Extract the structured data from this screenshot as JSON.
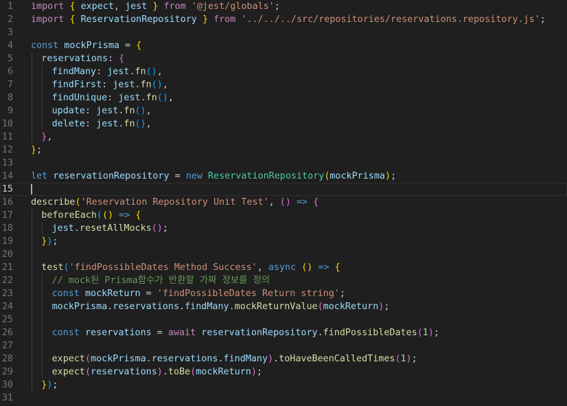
{
  "editor": {
    "caret_line": 15,
    "lines": [
      {
        "n": "1",
        "indent": 0,
        "tokens": [
          [
            "kw",
            "import"
          ],
          [
            "p",
            " "
          ],
          [
            "b1",
            "{"
          ],
          [
            "p",
            " "
          ],
          [
            "var",
            "expect"
          ],
          [
            "p",
            ", "
          ],
          [
            "var",
            "jest"
          ],
          [
            "p",
            " "
          ],
          [
            "b1",
            "}"
          ],
          [
            "p",
            " "
          ],
          [
            "kw",
            "from"
          ],
          [
            "p",
            " "
          ],
          [
            "str",
            "'@jest/globals'"
          ],
          [
            "p",
            ";"
          ]
        ]
      },
      {
        "n": "2",
        "indent": 0,
        "tokens": [
          [
            "kw",
            "import"
          ],
          [
            "p",
            " "
          ],
          [
            "b1",
            "{"
          ],
          [
            "p",
            " "
          ],
          [
            "var",
            "ReservationRepository"
          ],
          [
            "p",
            " "
          ],
          [
            "b1",
            "}"
          ],
          [
            "p",
            " "
          ],
          [
            "kw",
            "from"
          ],
          [
            "p",
            " "
          ],
          [
            "str",
            "'../../../src/repositories/reservations.repository.js'"
          ],
          [
            "p",
            ";"
          ]
        ]
      },
      {
        "n": "3",
        "indent": 0,
        "tokens": []
      },
      {
        "n": "4",
        "indent": 0,
        "tokens": [
          [
            "st",
            "const"
          ],
          [
            "p",
            " "
          ],
          [
            "var",
            "mockPrisma"
          ],
          [
            "p",
            " = "
          ],
          [
            "b1",
            "{"
          ]
        ]
      },
      {
        "n": "5",
        "indent": 1,
        "tokens": [
          [
            "var",
            "reservations"
          ],
          [
            "p",
            ": "
          ],
          [
            "b2",
            "{"
          ]
        ]
      },
      {
        "n": "6",
        "indent": 2,
        "tokens": [
          [
            "var",
            "findMany"
          ],
          [
            "p",
            ": "
          ],
          [
            "var",
            "jest"
          ],
          [
            "p",
            "."
          ],
          [
            "fn",
            "fn"
          ],
          [
            "b3",
            "()"
          ],
          [
            "p",
            ","
          ]
        ]
      },
      {
        "n": "7",
        "indent": 2,
        "tokens": [
          [
            "var",
            "findFirst"
          ],
          [
            "p",
            ": "
          ],
          [
            "var",
            "jest"
          ],
          [
            "p",
            "."
          ],
          [
            "fn",
            "fn"
          ],
          [
            "b3",
            "()"
          ],
          [
            "p",
            ","
          ]
        ]
      },
      {
        "n": "8",
        "indent": 2,
        "tokens": [
          [
            "var",
            "findUnique"
          ],
          [
            "p",
            ": "
          ],
          [
            "var",
            "jest"
          ],
          [
            "p",
            "."
          ],
          [
            "fn",
            "fn"
          ],
          [
            "b3",
            "()"
          ],
          [
            "p",
            ","
          ]
        ]
      },
      {
        "n": "9",
        "indent": 2,
        "tokens": [
          [
            "var",
            "update"
          ],
          [
            "p",
            ": "
          ],
          [
            "var",
            "jest"
          ],
          [
            "p",
            "."
          ],
          [
            "fn",
            "fn"
          ],
          [
            "b3",
            "()"
          ],
          [
            "p",
            ","
          ]
        ]
      },
      {
        "n": "10",
        "indent": 2,
        "tokens": [
          [
            "var",
            "delete"
          ],
          [
            "p",
            ": "
          ],
          [
            "var",
            "jest"
          ],
          [
            "p",
            "."
          ],
          [
            "fn",
            "fn"
          ],
          [
            "b3",
            "()"
          ],
          [
            "p",
            ","
          ]
        ]
      },
      {
        "n": "11",
        "indent": 1,
        "tokens": [
          [
            "b2",
            "}"
          ],
          [
            "p",
            ","
          ]
        ]
      },
      {
        "n": "12",
        "indent": 0,
        "tokens": [
          [
            "b1",
            "}"
          ],
          [
            "p",
            ";"
          ]
        ]
      },
      {
        "n": "13",
        "indent": 0,
        "tokens": []
      },
      {
        "n": "14",
        "indent": 0,
        "tokens": [
          [
            "st",
            "let"
          ],
          [
            "p",
            " "
          ],
          [
            "var",
            "reservationRepository"
          ],
          [
            "p",
            " = "
          ],
          [
            "st",
            "new"
          ],
          [
            "p",
            " "
          ],
          [
            "cls",
            "ReservationRepository"
          ],
          [
            "b1",
            "("
          ],
          [
            "var",
            "mockPrisma"
          ],
          [
            "b1",
            ")"
          ],
          [
            "p",
            ";"
          ]
        ]
      },
      {
        "n": "15",
        "indent": 0,
        "tokens": []
      },
      {
        "n": "16",
        "indent": 0,
        "tokens": [
          [
            "fn",
            "describe"
          ],
          [
            "b1",
            "("
          ],
          [
            "str",
            "'Reservation Repository Unit Test'"
          ],
          [
            "p",
            ", "
          ],
          [
            "b2",
            "()"
          ],
          [
            "p",
            " "
          ],
          [
            "st",
            "=>"
          ],
          [
            "p",
            " "
          ],
          [
            "b2",
            "{"
          ]
        ]
      },
      {
        "n": "17",
        "indent": 1,
        "tokens": [
          [
            "fn",
            "beforeEach"
          ],
          [
            "b3",
            "("
          ],
          [
            "b1",
            "()"
          ],
          [
            "p",
            " "
          ],
          [
            "st",
            "=>"
          ],
          [
            "p",
            " "
          ],
          [
            "b1",
            "{"
          ]
        ]
      },
      {
        "n": "18",
        "indent": 2,
        "tokens": [
          [
            "var",
            "jest"
          ],
          [
            "p",
            "."
          ],
          [
            "fn",
            "resetAllMocks"
          ],
          [
            "b2",
            "()"
          ],
          [
            "p",
            ";"
          ]
        ]
      },
      {
        "n": "19",
        "indent": 1,
        "tokens": [
          [
            "b1",
            "}"
          ],
          [
            "b3",
            ")"
          ],
          [
            "p",
            ";"
          ]
        ]
      },
      {
        "n": "20",
        "indent": 1,
        "tokens": []
      },
      {
        "n": "21",
        "indent": 1,
        "tokens": [
          [
            "fn",
            "test"
          ],
          [
            "b3",
            "("
          ],
          [
            "str",
            "'findPossibleDates Method Success'"
          ],
          [
            "p",
            ", "
          ],
          [
            "st",
            "async"
          ],
          [
            "p",
            " "
          ],
          [
            "b1",
            "()"
          ],
          [
            "p",
            " "
          ],
          [
            "st",
            "=>"
          ],
          [
            "p",
            " "
          ],
          [
            "b1",
            "{"
          ]
        ]
      },
      {
        "n": "22",
        "indent": 2,
        "tokens": [
          [
            "cm",
            "// mock된 Prisma함수가 반환할 가짜 정보를 정의"
          ]
        ]
      },
      {
        "n": "23",
        "indent": 2,
        "tokens": [
          [
            "st",
            "const"
          ],
          [
            "p",
            " "
          ],
          [
            "var",
            "mockReturn"
          ],
          [
            "p",
            " = "
          ],
          [
            "str",
            "'findPossibleDates Return string'"
          ],
          [
            "p",
            ";"
          ]
        ]
      },
      {
        "n": "24",
        "indent": 2,
        "tokens": [
          [
            "var",
            "mockPrisma"
          ],
          [
            "p",
            "."
          ],
          [
            "var",
            "reservations"
          ],
          [
            "p",
            "."
          ],
          [
            "var",
            "findMany"
          ],
          [
            "p",
            "."
          ],
          [
            "fn",
            "mockReturnValue"
          ],
          [
            "b2",
            "("
          ],
          [
            "var",
            "mockReturn"
          ],
          [
            "b2",
            ")"
          ],
          [
            "p",
            ";"
          ]
        ]
      },
      {
        "n": "25",
        "indent": 2,
        "tokens": []
      },
      {
        "n": "26",
        "indent": 2,
        "tokens": [
          [
            "st",
            "const"
          ],
          [
            "p",
            " "
          ],
          [
            "var",
            "reservations"
          ],
          [
            "p",
            " = "
          ],
          [
            "kw",
            "await"
          ],
          [
            "p",
            " "
          ],
          [
            "var",
            "reservationRepository"
          ],
          [
            "p",
            "."
          ],
          [
            "fn",
            "findPossibleDates"
          ],
          [
            "b2",
            "("
          ],
          [
            "num",
            "1"
          ],
          [
            "b2",
            ")"
          ],
          [
            "p",
            ";"
          ]
        ]
      },
      {
        "n": "27",
        "indent": 2,
        "tokens": []
      },
      {
        "n": "28",
        "indent": 2,
        "tokens": [
          [
            "fn",
            "expect"
          ],
          [
            "b2",
            "("
          ],
          [
            "var",
            "mockPrisma"
          ],
          [
            "p",
            "."
          ],
          [
            "var",
            "reservations"
          ],
          [
            "p",
            "."
          ],
          [
            "var",
            "findMany"
          ],
          [
            "b2",
            ")"
          ],
          [
            "p",
            "."
          ],
          [
            "fn",
            "toHaveBeenCalledTimes"
          ],
          [
            "b2",
            "("
          ],
          [
            "num",
            "1"
          ],
          [
            "b2",
            ")"
          ],
          [
            "p",
            ";"
          ]
        ]
      },
      {
        "n": "29",
        "indent": 2,
        "tokens": [
          [
            "fn",
            "expect"
          ],
          [
            "b2",
            "("
          ],
          [
            "var",
            "reservations"
          ],
          [
            "b2",
            ")"
          ],
          [
            "p",
            "."
          ],
          [
            "fn",
            "toBe"
          ],
          [
            "b2",
            "("
          ],
          [
            "var",
            "mockReturn"
          ],
          [
            "b2",
            ")"
          ],
          [
            "p",
            ";"
          ]
        ]
      },
      {
        "n": "30",
        "indent": 1,
        "tokens": [
          [
            "b1",
            "}"
          ],
          [
            "b3",
            ")"
          ],
          [
            "p",
            ";"
          ]
        ]
      },
      {
        "n": "31",
        "indent": 0,
        "tokens": []
      }
    ]
  }
}
